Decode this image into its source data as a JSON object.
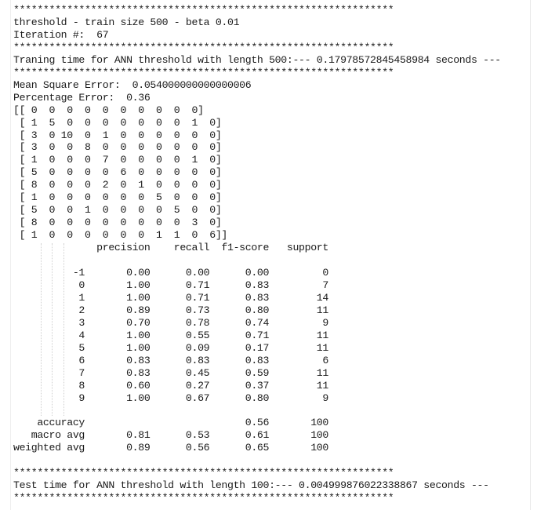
{
  "console": {
    "lines": [
      "****************************************************************",
      "threshold - train size 500 - beta 0.01",
      "Iteration #:  67",
      "****************************************************************",
      "Traning time for ANN threshold with length 500:--- 0.17978572845458984 seconds ---",
      "****************************************************************",
      "Mean Square Error:  0.054000000000000006",
      "Percentage Error:  0.36",
      "[[ 0  0  0  0  0  0  0  0  0  0]",
      " [ 1  5  0  0  0  0  0  0  0  1  0]",
      " [ 3  0 10  0  1  0  0  0  0  0  0]",
      " [ 3  0  0  8  0  0  0  0  0  0  0]",
      " [ 1  0  0  0  7  0  0  0  0  1  0]",
      " [ 5  0  0  0  0  6  0  0  0  0  0]",
      " [ 8  0  0  0  2  0  1  0  0  0  0]",
      " [ 1  0  0  0  0  0  0  5  0  0  0]",
      " [ 5  0  0  1  0  0  0  0  5  0  0]",
      " [ 8  0  0  0  0  0  0  0  0  3  0]",
      " [ 1  0  0  0  0  0  0  1  1  0  6]]",
      "              precision    recall  f1-score   support",
      "",
      "          -1       0.00      0.00      0.00         0",
      "           0       1.00      0.71      0.83         7",
      "           1       1.00      0.71      0.83        14",
      "           2       0.89      0.73      0.80        11",
      "           3       0.70      0.78      0.74         9",
      "           4       1.00      0.55      0.71        11",
      "           5       1.00      0.09      0.17        11",
      "           6       0.83      0.83      0.83         6",
      "           7       0.83      0.45      0.59        11",
      "           8       0.60      0.27      0.37        11",
      "           9       1.00      0.67      0.80         9",
      "",
      "    accuracy                           0.56       100",
      "   macro avg       0.81      0.53      0.61       100",
      "weighted avg       0.89      0.56      0.65       100",
      "",
      "****************************************************************",
      "Test time for ANN threshold with length 100:--- 0.004999876022338867 seconds ---",
      "****************************************************************"
    ]
  }
}
